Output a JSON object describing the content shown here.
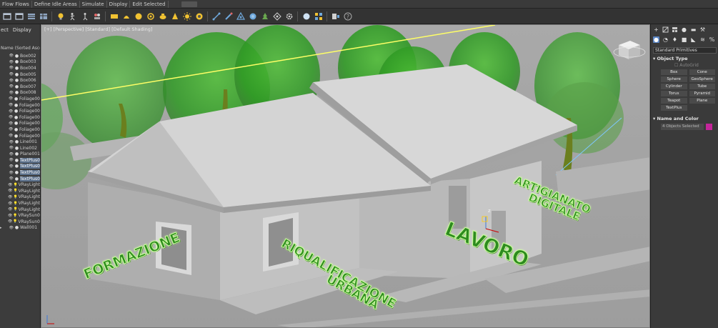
{
  "menubar": {
    "items": [
      "Flow Flows",
      "Define Idle Areas",
      "Simulate",
      "Display",
      "Edit Selected"
    ]
  },
  "toolbar": {
    "buttons": [
      "window-icon",
      "window-icon",
      "table-icon",
      "table-icon",
      "light-bulb-icon",
      "walk-icon",
      "walk-icon",
      "people-icon",
      "box-icon",
      "plane-icon",
      "sphere-icon",
      "cone-icon",
      "teapot-icon",
      "sun-icon",
      "sphere-icon",
      "node-icon",
      "paint-icon",
      "group-icon",
      "globe-icon",
      "tree-icon",
      "puzzle-icon",
      "gear-icon",
      "sphere-icon",
      "grid-icon",
      "render-icon",
      "help-icon"
    ]
  },
  "explorer": {
    "tabs": [
      "ect",
      "Display"
    ],
    "column_header": "Name (Sorted Ascen",
    "items": [
      {
        "name": "Box002",
        "icon": "box"
      },
      {
        "name": "Box003",
        "icon": "box"
      },
      {
        "name": "Box004",
        "icon": "box"
      },
      {
        "name": "Box005",
        "icon": "box"
      },
      {
        "name": "Box006",
        "icon": "box"
      },
      {
        "name": "Box007",
        "icon": "box"
      },
      {
        "name": "Box008",
        "icon": "box"
      },
      {
        "name": "Foliage00",
        "icon": "box"
      },
      {
        "name": "Foliage00",
        "icon": "box"
      },
      {
        "name": "Foliage00",
        "icon": "box"
      },
      {
        "name": "Foliage00",
        "icon": "box"
      },
      {
        "name": "Foliage00",
        "icon": "box"
      },
      {
        "name": "Foliage00",
        "icon": "box"
      },
      {
        "name": "Foliage00",
        "icon": "box"
      },
      {
        "name": "Line001",
        "icon": "box"
      },
      {
        "name": "Line002",
        "icon": "box"
      },
      {
        "name": "Plane001",
        "icon": "box"
      },
      {
        "name": "TextPlus0",
        "icon": "box",
        "selected": true
      },
      {
        "name": "TextPlus0",
        "icon": "box",
        "selected": true
      },
      {
        "name": "TextPlus0",
        "icon": "box",
        "selected": true
      },
      {
        "name": "TextPlus0",
        "icon": "box",
        "selected": true
      },
      {
        "name": "VRayLight",
        "icon": "light"
      },
      {
        "name": "VRayLight",
        "icon": "light"
      },
      {
        "name": "VRayLight",
        "icon": "light"
      },
      {
        "name": "VRayLight",
        "icon": "light"
      },
      {
        "name": "VRayLight",
        "icon": "light"
      },
      {
        "name": "VRaySun0",
        "icon": "light"
      },
      {
        "name": "VRaySun0",
        "icon": "light"
      },
      {
        "name": "Wall001",
        "icon": "box",
        "arrow": true
      }
    ]
  },
  "viewport": {
    "label": "[+] [Perspective] [Standard] [Default Shading]",
    "scene_texts": [
      "FORMAZIONE",
      "RIQUALIFICAZIONE",
      "URBANA",
      "LAVORO",
      "ARTIGIANATO",
      "DIGITALE"
    ],
    "gizmo_axis": "z"
  },
  "command_panel": {
    "top_icons": [
      "plus-icon",
      "modify-icon",
      "hierarchy-icon",
      "motion-icon",
      "display-icon",
      "utilities-icon"
    ],
    "sub_icons": [
      "geometry-icon",
      "shapes-icon",
      "lights-icon",
      "cameras-icon",
      "helpers-icon",
      "spacewarps-icon",
      "systems-icon"
    ],
    "dropdown": "Standard Primitives",
    "object_type_title": "Object Type",
    "autogrid": "AutoGrid",
    "primitives": [
      "Box",
      "Cone",
      "Sphere",
      "GeoSphere",
      "Cylinder",
      "Tube",
      "Torus",
      "Pyramid",
      "Teapot",
      "Plane",
      "TextPlus"
    ],
    "name_color_title": "Name and Color",
    "name_field": "4 Objects Selected",
    "color_swatch": "#c4259a"
  },
  "colors": {
    "viewport_bg": "#a7a7a7",
    "text_green": "#2e8b1f",
    "selection_blue": "#5a6f8a"
  }
}
